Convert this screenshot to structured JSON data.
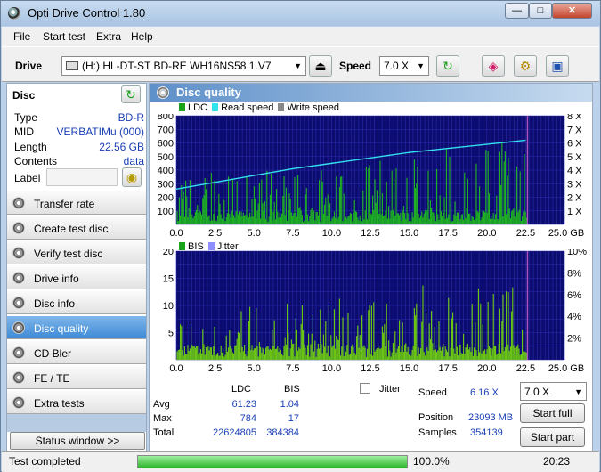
{
  "window": {
    "title": "Opti Drive Control 1.80"
  },
  "menu": [
    "File",
    "Start test",
    "Extra",
    "Help"
  ],
  "toolbar": {
    "drive_label": "Drive",
    "drive_value": "(H:)  HL-DT-ST BD-RE  WH16NS58 1.V7",
    "speed_label": "Speed",
    "speed_value": "7.0 X"
  },
  "disc": {
    "header": "Disc",
    "rows": [
      {
        "key": "Type",
        "value": "BD-R"
      },
      {
        "key": "MID",
        "value": "VERBATIMu (000)"
      },
      {
        "key": "Length",
        "value": "22.56 GB"
      },
      {
        "key": "Contents",
        "value": "data"
      }
    ],
    "label_key": "Label"
  },
  "nav": [
    {
      "label": "Transfer rate",
      "active": false
    },
    {
      "label": "Create test disc",
      "active": false
    },
    {
      "label": "Verify test disc",
      "active": false
    },
    {
      "label": "Drive info",
      "active": false
    },
    {
      "label": "Disc info",
      "active": false
    },
    {
      "label": "Disc quality",
      "active": true
    },
    {
      "label": "CD Bler",
      "active": false
    },
    {
      "label": "FE / TE",
      "active": false
    },
    {
      "label": "Extra tests",
      "active": false
    }
  ],
  "status_window_button": "Status window >>",
  "panel_title": "Disc quality",
  "top_legend": [
    {
      "name": "LDC",
      "color": "#1aa31a"
    },
    {
      "name": "Read speed",
      "color": "#33e0ee"
    },
    {
      "name": "Write speed",
      "color": "#888888"
    }
  ],
  "bottom_legend": [
    {
      "name": "BIS",
      "color": "#1aa31a"
    },
    {
      "name": "Jitter",
      "color": "#8e8eff"
    }
  ],
  "chart_data": [
    {
      "type": "bar",
      "series_name": "LDC",
      "x_ticks": [
        "0.0",
        "2.5",
        "5.0",
        "7.5",
        "10.0",
        "12.5",
        "15.0",
        "17.5",
        "20.0",
        "22.5",
        "25.0 GB"
      ],
      "y_ticks_left": [
        "800",
        "700",
        "600",
        "500",
        "400",
        "300",
        "200",
        "100"
      ],
      "y_ticks_right": [
        "8 X",
        "7 X",
        "6 X",
        "5 X",
        "4 X",
        "3 X",
        "2 X",
        "1 X"
      ],
      "xlim": [
        0,
        25
      ],
      "ylim": [
        0,
        800
      ],
      "data_end_gb": 22.56,
      "read_speed_x": [
        0,
        2.5,
        5,
        7.5,
        10,
        12.5,
        15,
        17.5,
        20,
        22.5
      ],
      "read_speed_y": [
        2.6,
        3.1,
        3.6,
        4.1,
        4.5,
        4.9,
        5.3,
        5.6,
        5.9,
        6.2
      ]
    },
    {
      "type": "bar",
      "series_name": "BIS",
      "x_ticks": [
        "0.0",
        "2.5",
        "5.0",
        "7.5",
        "10.0",
        "12.5",
        "15.0",
        "17.5",
        "20.0",
        "22.5",
        "25.0 GB"
      ],
      "y_ticks_left": [
        "20",
        "15",
        "10",
        "5"
      ],
      "y_ticks_right": [
        "10%",
        "8%",
        "6%",
        "4%",
        "2%"
      ],
      "xlim": [
        0,
        25
      ],
      "ylim": [
        0,
        20
      ],
      "data_end_gb": 22.56
    }
  ],
  "stats": {
    "col_ldc": "LDC",
    "col_bis": "BIS",
    "jitter_label": "Jitter",
    "rows": [
      {
        "label": "Avg",
        "ldc": "61.23",
        "bis": "1.04"
      },
      {
        "label": "Max",
        "ldc": "784",
        "bis": "17"
      },
      {
        "label": "Total",
        "ldc": "22624805",
        "bis": "384384"
      }
    ],
    "speed_label": "Speed",
    "speed_value": "6.16 X",
    "position_label": "Position",
    "position_value": "23093 MB",
    "samples_label": "Samples",
    "samples_value": "354139",
    "speed_select": "7.0 X",
    "start_full": "Start full",
    "start_part": "Start part"
  },
  "statusbar": {
    "text": "Test completed",
    "progress_percent": 100.0,
    "progress_text": "100.0%",
    "time": "20:23"
  }
}
